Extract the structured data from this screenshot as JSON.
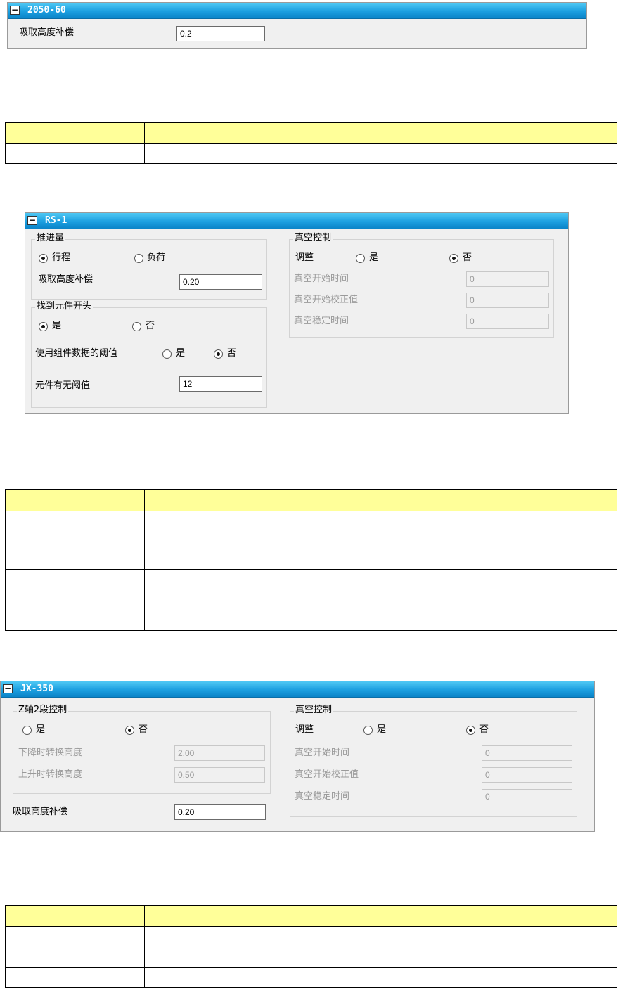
{
  "panel1": {
    "title": "2050-60",
    "pickup_height_label": "吸取高度补偿",
    "pickup_height_value": "0.2"
  },
  "panel2": {
    "title": "RS-1",
    "push_group": {
      "legend": "推进量",
      "option_stroke": "行程",
      "option_load": "负荷",
      "selected": "stroke",
      "pickup_height_label": "吸取高度补偿",
      "pickup_height_value": "0.20"
    },
    "find_group": {
      "legend": "找到元件开头",
      "option_yes": "是",
      "option_no": "否",
      "selected": "yes",
      "threshold_label": "使用组件数据的阈值",
      "threshold_yes": "是",
      "threshold_no": "否",
      "threshold_selected": "no",
      "presence_label": "元件有无阈值",
      "presence_value": "12"
    },
    "vacuum_group": {
      "legend": "真空控制",
      "adjust_label": "调整",
      "option_yes": "是",
      "option_no": "否",
      "selected": "no",
      "start_time_label": "真空开始时间",
      "start_time_value": "0",
      "start_corr_label": "真空开始校正值",
      "start_corr_value": "0",
      "stable_time_label": "真空稳定时间",
      "stable_time_value": "0"
    }
  },
  "panel3": {
    "title": "JX-350",
    "z_group": {
      "legend": "Z轴2段控制",
      "option_yes": "是",
      "option_no": "否",
      "selected": "no",
      "down_label": "下降时转换高度",
      "down_value": "2.00",
      "up_label": "上升时转换高度",
      "up_value": "0.50"
    },
    "pickup_height_label": "吸取高度补偿",
    "pickup_height_value": "0.20",
    "vacuum_group": {
      "legend": "真空控制",
      "adjust_label": "调整",
      "option_yes": "是",
      "option_no": "否",
      "selected": "no",
      "start_time_label": "真空开始时间",
      "start_time_value": "0",
      "start_corr_label": "真空开始校正值",
      "start_corr_value": "0",
      "stable_time_label": "真空稳定时间",
      "stable_time_value": "0"
    }
  },
  "colors": {
    "title_bar": "#1c9fe0",
    "table_header": "#ffff99",
    "panel_bg": "#f0f0f0"
  }
}
